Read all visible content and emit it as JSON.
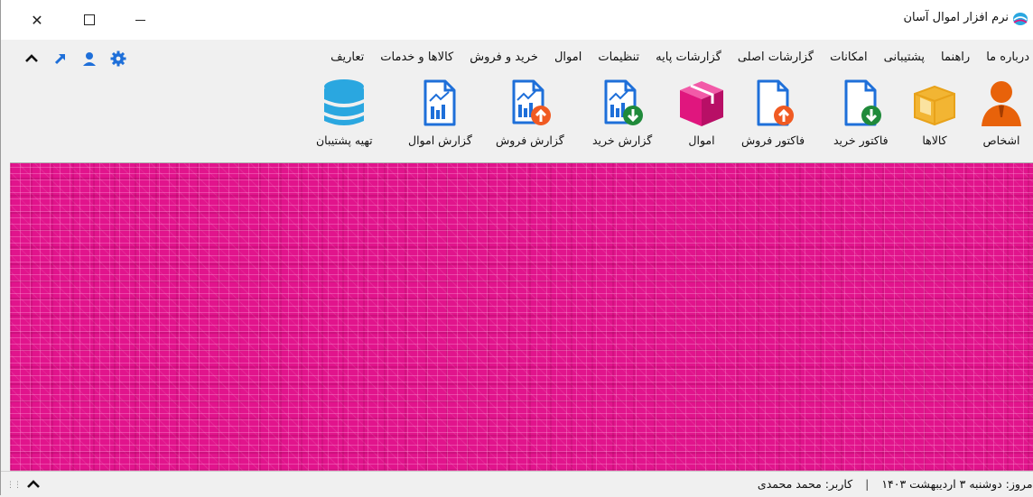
{
  "window": {
    "title": "نرم افزار اموال آسان"
  },
  "menu": {
    "items": [
      "تعاریف",
      "کالاها و خدمات",
      "خرید و فروش",
      "اموال",
      "تنظیمات",
      "گزارشات پایه",
      "گزارشات اصلی",
      "امکانات",
      "پشتیبانی",
      "راهنما",
      "درباره ما"
    ]
  },
  "quick_icons": [
    "settings-gear-icon",
    "user-icon",
    "shortcut-arrow-icon",
    "collapse-up-icon"
  ],
  "toolbar": {
    "items": [
      {
        "label": "اشخاص",
        "icon": "person-icon"
      },
      {
        "label": "کالاها",
        "icon": "box-icon"
      },
      {
        "label": "فاکتور خرید",
        "icon": "invoice-download-icon"
      },
      {
        "label": "فاکتور فروش",
        "icon": "invoice-upload-icon"
      },
      {
        "label": "اموال",
        "icon": "package-icon"
      },
      {
        "label": "گزارش خرید",
        "icon": "report-download-icon"
      },
      {
        "label": "گزارش فروش",
        "icon": "report-upload-icon"
      },
      {
        "label": "گزارش اموال",
        "icon": "report-icon"
      },
      {
        "label": "تهیه پشتیبان",
        "icon": "database-icon"
      }
    ]
  },
  "status": {
    "date_text": "امروز: دوشنبه ۳ اردیبهشت ۱۴۰۳",
    "user_text": "کاربر: محمد محمدی"
  },
  "colors": {
    "workspace": "#e1148c",
    "accent_blue": "#1e6fd9",
    "person_orange": "#e8620a",
    "box_gold": "#f2b533",
    "package_pink": "#e0167e",
    "upload_orange": "#f05a22",
    "download_green": "#1f8a3a",
    "database_blue": "#2aa7e0"
  }
}
